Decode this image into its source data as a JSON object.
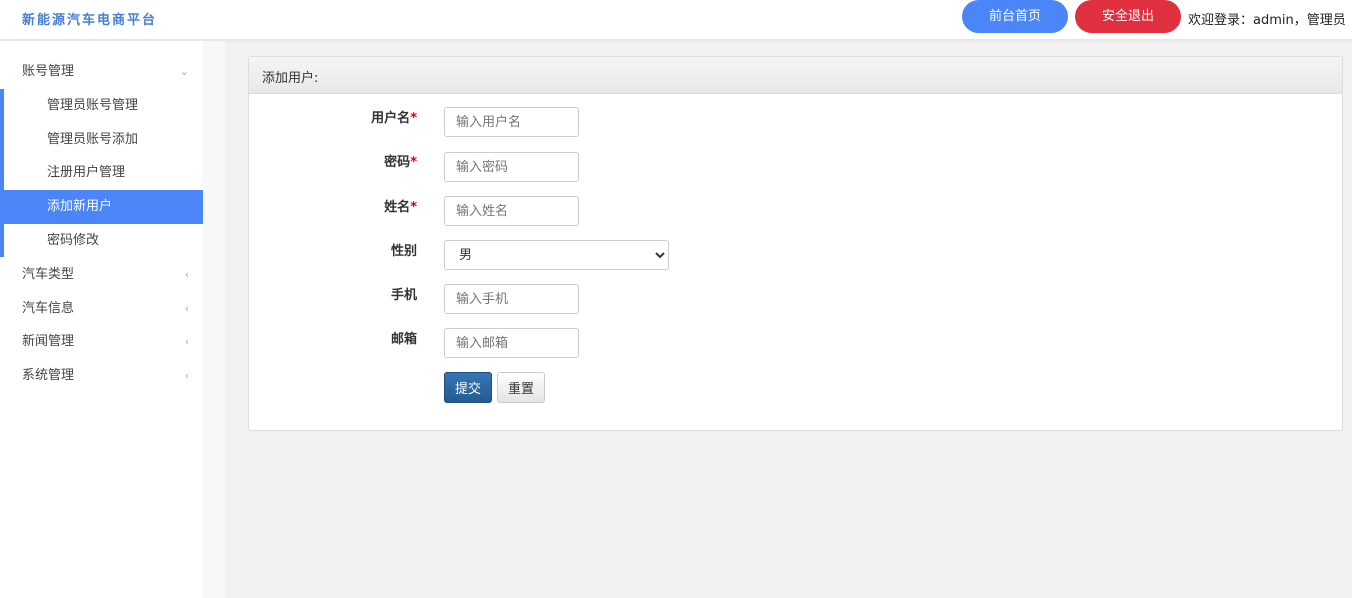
{
  "header": {
    "logo": "新能源汽车电商平台",
    "home_button": "前台首页",
    "logout_button": "安全退出",
    "welcome": "欢迎登录：admin，管理员"
  },
  "sidebar": {
    "groups": [
      {
        "label": "账号管理",
        "expanded": true,
        "items": [
          {
            "label": "管理员账号管理"
          },
          {
            "label": "管理员账号添加"
          },
          {
            "label": "注册用户管理"
          },
          {
            "label": "添加新用户",
            "active": true
          },
          {
            "label": "密码修改"
          }
        ]
      },
      {
        "label": "汽车类型"
      },
      {
        "label": "汽车信息"
      },
      {
        "label": "新闻管理"
      },
      {
        "label": "系统管理"
      }
    ]
  },
  "form": {
    "title": "添加用户:",
    "fields": [
      {
        "label": "用户名",
        "required": "*",
        "placeholder": "输入用户名"
      },
      {
        "label": "密码",
        "required": "*",
        "placeholder": "输入密码"
      },
      {
        "label": "姓名",
        "required": "*",
        "placeholder": "输入姓名"
      },
      {
        "label": "性别",
        "value": "男"
      },
      {
        "label": "手机",
        "placeholder": "输入手机"
      },
      {
        "label": "邮箱",
        "placeholder": "输入邮箱"
      }
    ],
    "submit": "提交",
    "reset": "重置"
  },
  "colors": {
    "accent": "#4a86f7",
    "danger": "#e0303f",
    "primary_btn": "#2a679f"
  }
}
